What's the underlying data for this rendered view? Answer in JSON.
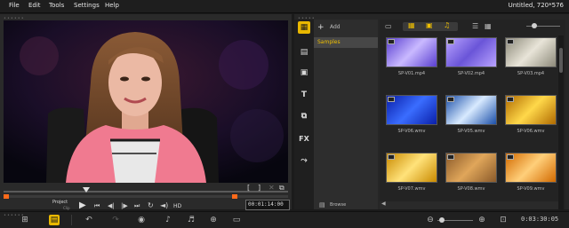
{
  "menu": {
    "items": [
      "File",
      "Edit",
      "Tools",
      "Settings",
      "Help"
    ],
    "project_info": "Untitled, 720*576"
  },
  "player": {
    "mode_project": "Project",
    "mode_clip": "Clip",
    "hd_label": "HD",
    "timecode": "00:01:14:00",
    "scrub_position": 0.29
  },
  "library": {
    "add_label": "Add",
    "folders": [
      "Samples"
    ],
    "browse_label": "Browse",
    "thumbnails": [
      {
        "label": "SP-V01.mp4",
        "colors": [
          "#5a3fd0",
          "#c9b9ff"
        ]
      },
      {
        "label": "SP-V02.mp4",
        "colors": [
          "#b9a3ff",
          "#6a55d8"
        ]
      },
      {
        "label": "SP-V03.mp4",
        "colors": [
          "#8d8a7a",
          "#e8e4d8"
        ]
      },
      {
        "label": "SP-V06.wmv",
        "colors": [
          "#0a1fa8",
          "#3a6dff"
        ]
      },
      {
        "label": "SP-V05.wmv",
        "colors": [
          "#1b4fa8",
          "#d8eaff"
        ]
      },
      {
        "label": "SP-V06.wmv",
        "colors": [
          "#b06a00",
          "#ffd84a"
        ]
      },
      {
        "label": "SP-V07.wmv",
        "colors": [
          "#c98a00",
          "#ffe27a"
        ]
      },
      {
        "label": "SP-V08.wmv",
        "colors": [
          "#8a5a2a",
          "#e0a65a"
        ]
      },
      {
        "label": "SP-V09.wmv",
        "colors": [
          "#d26a00",
          "#ffcf7a"
        ]
      }
    ]
  },
  "timeline": {
    "timecode": "0:03:30:05"
  },
  "colors": {
    "accent": "#f0c000",
    "scrub_marker": "#ff6a1a",
    "folder_selected": "#4a4a4a"
  }
}
